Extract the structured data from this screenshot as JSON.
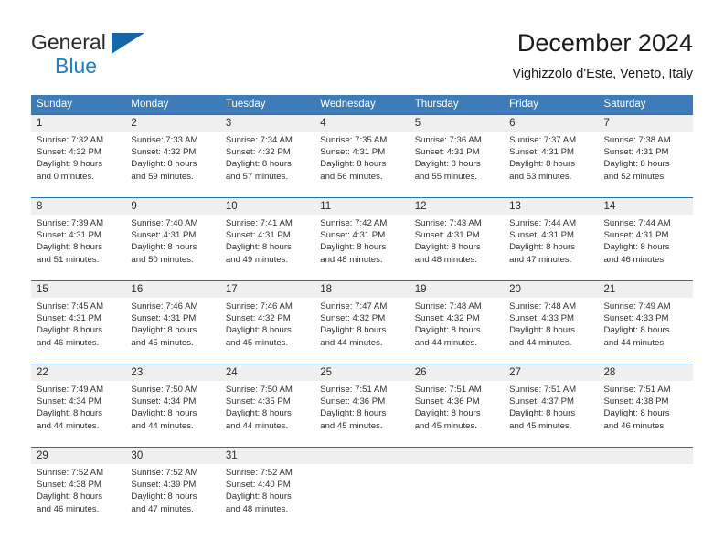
{
  "brand": {
    "name_part1": "General",
    "name_part2": "Blue",
    "triangle_icon": "triangle-logo-icon",
    "color_dark": "#2b2b2b",
    "color_blue": "#1f7fc4"
  },
  "header": {
    "title": "December 2024",
    "location": "Vighizzolo d'Este, Veneto, Italy"
  },
  "theme": {
    "header_bar": "#3d7cb8",
    "week_rule": "#2f6da8",
    "date_band": "#efefef",
    "text": "#303030"
  },
  "weekdays": [
    "Sunday",
    "Monday",
    "Tuesday",
    "Wednesday",
    "Thursday",
    "Friday",
    "Saturday"
  ],
  "weeks": [
    {
      "days": [
        {
          "date": "1",
          "sunrise": "Sunrise: 7:32 AM",
          "sunset": "Sunset: 4:32 PM",
          "daylight1": "Daylight: 9 hours",
          "daylight2": "and 0 minutes."
        },
        {
          "date": "2",
          "sunrise": "Sunrise: 7:33 AM",
          "sunset": "Sunset: 4:32 PM",
          "daylight1": "Daylight: 8 hours",
          "daylight2": "and 59 minutes."
        },
        {
          "date": "3",
          "sunrise": "Sunrise: 7:34 AM",
          "sunset": "Sunset: 4:32 PM",
          "daylight1": "Daylight: 8 hours",
          "daylight2": "and 57 minutes."
        },
        {
          "date": "4",
          "sunrise": "Sunrise: 7:35 AM",
          "sunset": "Sunset: 4:31 PM",
          "daylight1": "Daylight: 8 hours",
          "daylight2": "and 56 minutes."
        },
        {
          "date": "5",
          "sunrise": "Sunrise: 7:36 AM",
          "sunset": "Sunset: 4:31 PM",
          "daylight1": "Daylight: 8 hours",
          "daylight2": "and 55 minutes."
        },
        {
          "date": "6",
          "sunrise": "Sunrise: 7:37 AM",
          "sunset": "Sunset: 4:31 PM",
          "daylight1": "Daylight: 8 hours",
          "daylight2": "and 53 minutes."
        },
        {
          "date": "7",
          "sunrise": "Sunrise: 7:38 AM",
          "sunset": "Sunset: 4:31 PM",
          "daylight1": "Daylight: 8 hours",
          "daylight2": "and 52 minutes."
        }
      ]
    },
    {
      "days": [
        {
          "date": "8",
          "sunrise": "Sunrise: 7:39 AM",
          "sunset": "Sunset: 4:31 PM",
          "daylight1": "Daylight: 8 hours",
          "daylight2": "and 51 minutes."
        },
        {
          "date": "9",
          "sunrise": "Sunrise: 7:40 AM",
          "sunset": "Sunset: 4:31 PM",
          "daylight1": "Daylight: 8 hours",
          "daylight2": "and 50 minutes."
        },
        {
          "date": "10",
          "sunrise": "Sunrise: 7:41 AM",
          "sunset": "Sunset: 4:31 PM",
          "daylight1": "Daylight: 8 hours",
          "daylight2": "and 49 minutes."
        },
        {
          "date": "11",
          "sunrise": "Sunrise: 7:42 AM",
          "sunset": "Sunset: 4:31 PM",
          "daylight1": "Daylight: 8 hours",
          "daylight2": "and 48 minutes."
        },
        {
          "date": "12",
          "sunrise": "Sunrise: 7:43 AM",
          "sunset": "Sunset: 4:31 PM",
          "daylight1": "Daylight: 8 hours",
          "daylight2": "and 48 minutes."
        },
        {
          "date": "13",
          "sunrise": "Sunrise: 7:44 AM",
          "sunset": "Sunset: 4:31 PM",
          "daylight1": "Daylight: 8 hours",
          "daylight2": "and 47 minutes."
        },
        {
          "date": "14",
          "sunrise": "Sunrise: 7:44 AM",
          "sunset": "Sunset: 4:31 PM",
          "daylight1": "Daylight: 8 hours",
          "daylight2": "and 46 minutes."
        }
      ]
    },
    {
      "days": [
        {
          "date": "15",
          "sunrise": "Sunrise: 7:45 AM",
          "sunset": "Sunset: 4:31 PM",
          "daylight1": "Daylight: 8 hours",
          "daylight2": "and 46 minutes."
        },
        {
          "date": "16",
          "sunrise": "Sunrise: 7:46 AM",
          "sunset": "Sunset: 4:31 PM",
          "daylight1": "Daylight: 8 hours",
          "daylight2": "and 45 minutes."
        },
        {
          "date": "17",
          "sunrise": "Sunrise: 7:46 AM",
          "sunset": "Sunset: 4:32 PM",
          "daylight1": "Daylight: 8 hours",
          "daylight2": "and 45 minutes."
        },
        {
          "date": "18",
          "sunrise": "Sunrise: 7:47 AM",
          "sunset": "Sunset: 4:32 PM",
          "daylight1": "Daylight: 8 hours",
          "daylight2": "and 44 minutes."
        },
        {
          "date": "19",
          "sunrise": "Sunrise: 7:48 AM",
          "sunset": "Sunset: 4:32 PM",
          "daylight1": "Daylight: 8 hours",
          "daylight2": "and 44 minutes."
        },
        {
          "date": "20",
          "sunrise": "Sunrise: 7:48 AM",
          "sunset": "Sunset: 4:33 PM",
          "daylight1": "Daylight: 8 hours",
          "daylight2": "and 44 minutes."
        },
        {
          "date": "21",
          "sunrise": "Sunrise: 7:49 AM",
          "sunset": "Sunset: 4:33 PM",
          "daylight1": "Daylight: 8 hours",
          "daylight2": "and 44 minutes."
        }
      ]
    },
    {
      "days": [
        {
          "date": "22",
          "sunrise": "Sunrise: 7:49 AM",
          "sunset": "Sunset: 4:34 PM",
          "daylight1": "Daylight: 8 hours",
          "daylight2": "and 44 minutes."
        },
        {
          "date": "23",
          "sunrise": "Sunrise: 7:50 AM",
          "sunset": "Sunset: 4:34 PM",
          "daylight1": "Daylight: 8 hours",
          "daylight2": "and 44 minutes."
        },
        {
          "date": "24",
          "sunrise": "Sunrise: 7:50 AM",
          "sunset": "Sunset: 4:35 PM",
          "daylight1": "Daylight: 8 hours",
          "daylight2": "and 44 minutes."
        },
        {
          "date": "25",
          "sunrise": "Sunrise: 7:51 AM",
          "sunset": "Sunset: 4:36 PM",
          "daylight1": "Daylight: 8 hours",
          "daylight2": "and 45 minutes."
        },
        {
          "date": "26",
          "sunrise": "Sunrise: 7:51 AM",
          "sunset": "Sunset: 4:36 PM",
          "daylight1": "Daylight: 8 hours",
          "daylight2": "and 45 minutes."
        },
        {
          "date": "27",
          "sunrise": "Sunrise: 7:51 AM",
          "sunset": "Sunset: 4:37 PM",
          "daylight1": "Daylight: 8 hours",
          "daylight2": "and 45 minutes."
        },
        {
          "date": "28",
          "sunrise": "Sunrise: 7:51 AM",
          "sunset": "Sunset: 4:38 PM",
          "daylight1": "Daylight: 8 hours",
          "daylight2": "and 46 minutes."
        }
      ]
    },
    {
      "days": [
        {
          "date": "29",
          "sunrise": "Sunrise: 7:52 AM",
          "sunset": "Sunset: 4:38 PM",
          "daylight1": "Daylight: 8 hours",
          "daylight2": "and 46 minutes."
        },
        {
          "date": "30",
          "sunrise": "Sunrise: 7:52 AM",
          "sunset": "Sunset: 4:39 PM",
          "daylight1": "Daylight: 8 hours",
          "daylight2": "and 47 minutes."
        },
        {
          "date": "31",
          "sunrise": "Sunrise: 7:52 AM",
          "sunset": "Sunset: 4:40 PM",
          "daylight1": "Daylight: 8 hours",
          "daylight2": "and 48 minutes."
        },
        {
          "date": "",
          "sunrise": "",
          "sunset": "",
          "daylight1": "",
          "daylight2": ""
        },
        {
          "date": "",
          "sunrise": "",
          "sunset": "",
          "daylight1": "",
          "daylight2": ""
        },
        {
          "date": "",
          "sunrise": "",
          "sunset": "",
          "daylight1": "",
          "daylight2": ""
        },
        {
          "date": "",
          "sunrise": "",
          "sunset": "",
          "daylight1": "",
          "daylight2": ""
        }
      ]
    }
  ]
}
